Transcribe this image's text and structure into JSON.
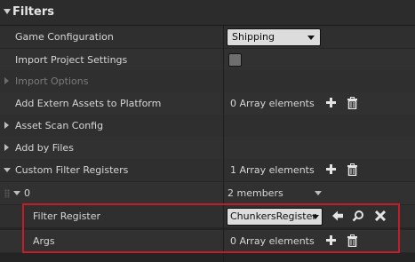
{
  "panel": {
    "title": "Filters"
  },
  "rows": {
    "game_config": {
      "label": "Game Configuration",
      "value": "Shipping"
    },
    "import_project_settings": {
      "label": "Import Project Settings",
      "checked": false
    },
    "import_options": {
      "label": "Import Options"
    },
    "add_extern_assets": {
      "label": "Add Extern Assets to Platform",
      "value": "0 Array elements"
    },
    "asset_scan_config": {
      "label": "Asset Scan Config"
    },
    "add_by_files": {
      "label": "Add by Files"
    },
    "custom_filter_registers": {
      "label": "Custom Filter Registers",
      "value": "1 Array elements"
    },
    "element_0": {
      "label": "0",
      "value": "2 members"
    },
    "filter_register": {
      "label": "Filter Register",
      "value": "ChunkersRegister"
    },
    "args": {
      "label": "Args",
      "value": "0 Array elements"
    }
  },
  "icons": {
    "add": "plus-icon",
    "delete": "trash-icon",
    "use_selected": "arrow-left-icon",
    "browse": "magnifier-icon",
    "clear": "close-icon"
  },
  "colors": {
    "highlight_box": "#c41d2a",
    "background": "#242424"
  }
}
